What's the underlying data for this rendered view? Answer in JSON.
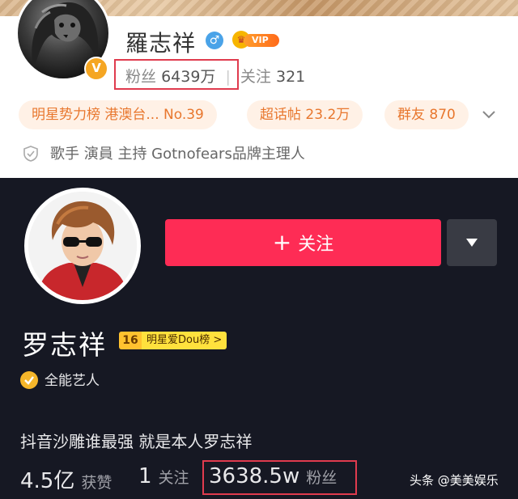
{
  "weibo": {
    "name": "羅志祥",
    "vip_label": "VIP 7",
    "fans_label": "粉丝",
    "fans_count": "6439万",
    "follow_label": "关注",
    "follow_count": "321",
    "chips": [
      {
        "label": "明星势力榜 港澳台... No.39"
      },
      {
        "label": "超话帖 23.2万"
      },
      {
        "label": "群友 870"
      }
    ],
    "bio": "歌手 演員 主持 Gotnofears品牌主理人",
    "colors": {
      "accent": "#e8772e",
      "chip_bg": "#fff1e6",
      "highlight_box": "#e03b4e"
    }
  },
  "douyin": {
    "follow_button_label": "关注",
    "name": "罗志祥",
    "rank_number": "16",
    "rank_label": "明星爱Dou榜 >",
    "verification": "全能艺人",
    "bio": "抖音沙雕谁最强 就是本人罗志祥",
    "stats": [
      {
        "value": "4.5亿",
        "label": "获赞"
      },
      {
        "value": "1",
        "label": "关注"
      },
      {
        "value": "3638.5w",
        "label": "粉丝"
      }
    ],
    "colors": {
      "background": "#161823",
      "follow_button": "#fe2c55",
      "text": "#e8e8ea"
    }
  },
  "watermark": "头条 @美美娱乐"
}
